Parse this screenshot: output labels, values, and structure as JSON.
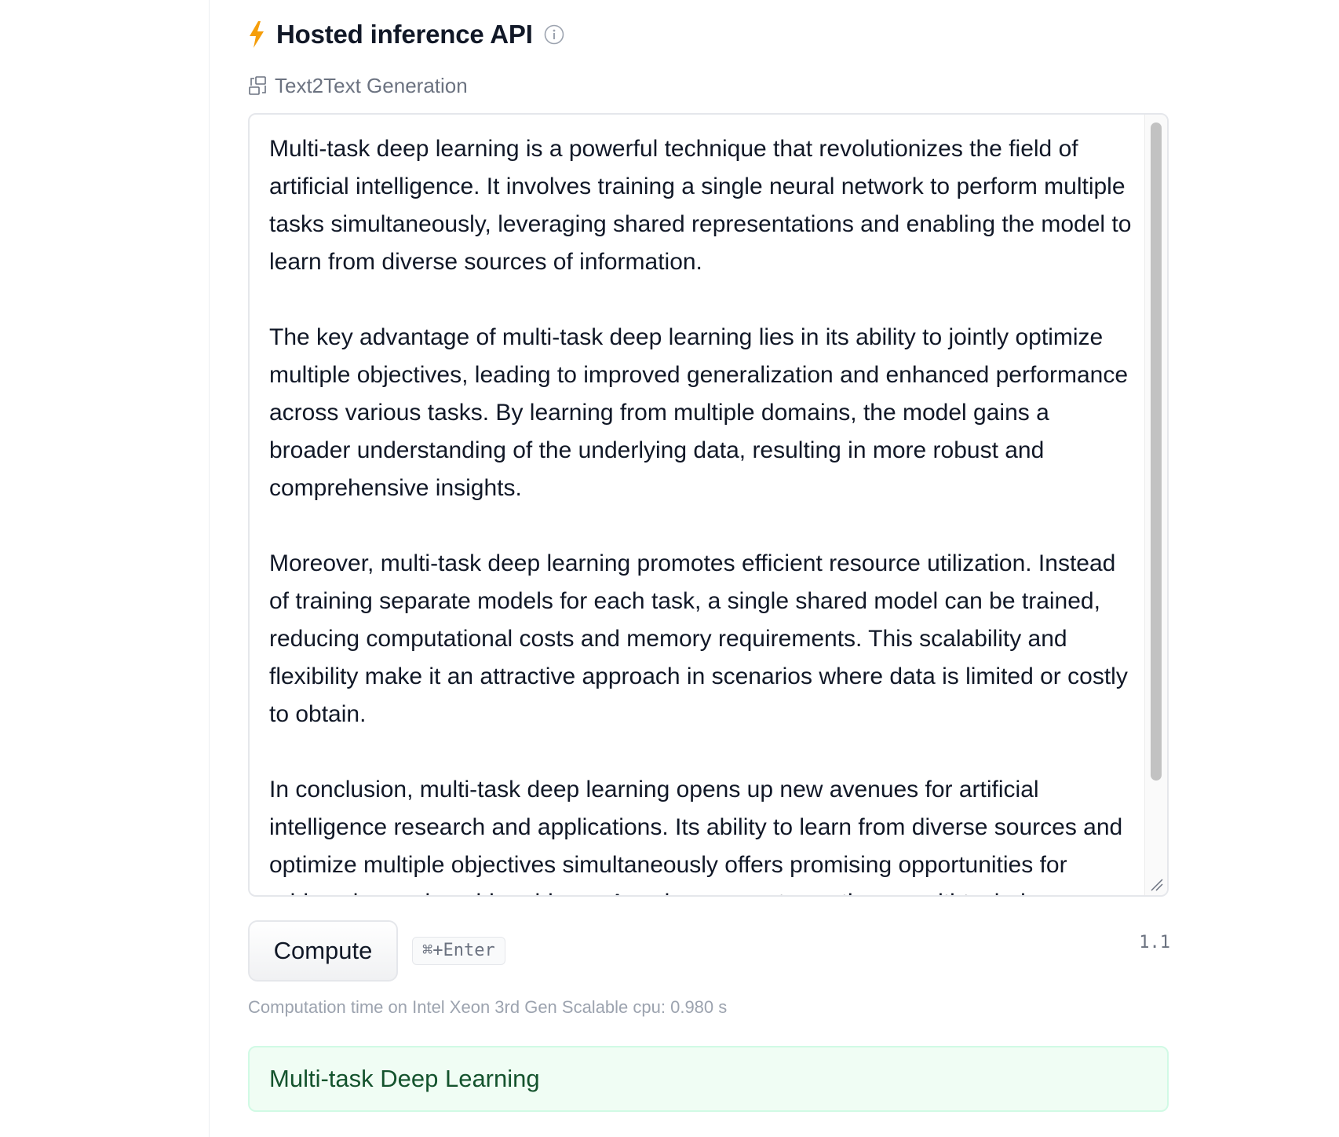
{
  "widget": {
    "title": "Hosted inference API",
    "title_icon": "bolt-icon",
    "info_icon": "info-icon",
    "accent_color": "#f59e0b"
  },
  "task": {
    "icon": "text2text-icon",
    "label": "Text2Text Generation"
  },
  "input": {
    "text": "Multi-task deep learning is a powerful technique that revolutionizes the field of artificial intelligence. It involves training a single neural network to perform multiple tasks simultaneously, leveraging shared representations and enabling the model to learn from diverse sources of information.\n\nThe key advantage of multi-task deep learning lies in its ability to jointly optimize multiple objectives, leading to improved generalization and enhanced performance across various tasks. By learning from multiple domains, the model gains a broader understanding of the underlying data, resulting in more robust and comprehensive insights.\n\nMoreover, multi-task deep learning promotes efficient resource utilization. Instead of training separate models for each task, a single shared model can be trained, reducing computational costs and memory requirements. This scalability and flexibility make it an attractive approach in scenarios where data is limited or costly to obtain.\n\nIn conclusion, multi-task deep learning opens up new avenues for artificial intelligence research and applications. Its ability to learn from diverse sources and optimize multiple objectives simultaneously offers promising opportunities for addressing real-world problems. As advancements continue, multi-task deep"
  },
  "actions": {
    "compute_label": "Compute",
    "shortcut": "⌘+Enter",
    "version": "1.1"
  },
  "status": {
    "computation_time": "Computation time on Intel Xeon 3rd Gen Scalable cpu: 0.980 s"
  },
  "output": {
    "text": "Multi-task Deep Learning",
    "background_color": "#f0fdf4",
    "text_color": "#14532d"
  }
}
